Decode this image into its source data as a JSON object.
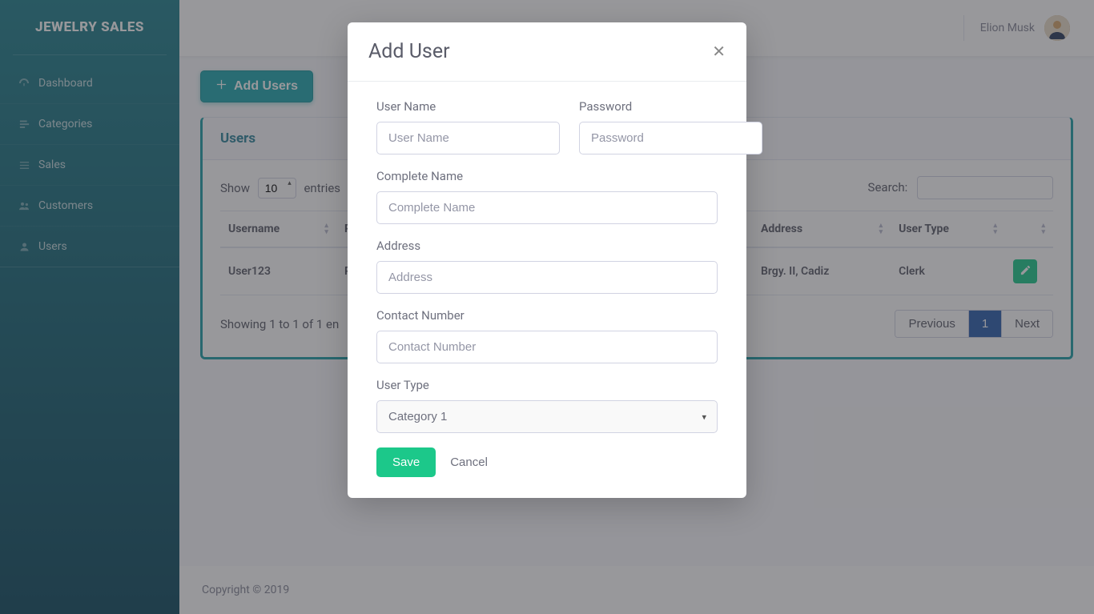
{
  "brand": "JEWELRY SALES",
  "sidebar": {
    "items": [
      {
        "label": "Dashboard",
        "icon": "dashboard-icon"
      },
      {
        "label": "Categories",
        "icon": "categories-icon"
      },
      {
        "label": "Sales",
        "icon": "sales-icon"
      },
      {
        "label": "Customers",
        "icon": "customers-icon"
      },
      {
        "label": "Users",
        "icon": "user-icon"
      }
    ]
  },
  "topbar": {
    "username": "Elion Musk"
  },
  "page": {
    "addButton": "Add Users",
    "cardTitle": "Users",
    "showLabel": "Show",
    "showValue": "10",
    "entriesLabel": "entries",
    "searchLabel": "Search:",
    "columns": [
      "Username",
      "Password",
      "",
      "",
      "Address",
      "User Type",
      ""
    ],
    "row": {
      "username": "User123",
      "password_prefix": "Pa",
      "address": "Brgy. II, Cadiz",
      "usertype": "Clerk"
    },
    "showing": "Showing 1 to 1 of 1 en",
    "prev": "Previous",
    "page1": "1",
    "next": "Next"
  },
  "footer": "Copyright © 2019",
  "modal": {
    "title": "Add User",
    "labels": {
      "username": "User Name",
      "password": "Password",
      "completeName": "Complete Name",
      "address": "Address",
      "contact": "Contact Number",
      "userType": "User Type"
    },
    "placeholders": {
      "username": "User Name",
      "password": "Password",
      "completeName": "Complete Name",
      "address": "Address",
      "contact": "Contact Number"
    },
    "userTypeSelected": "Category 1",
    "save": "Save",
    "cancel": "Cancel"
  }
}
